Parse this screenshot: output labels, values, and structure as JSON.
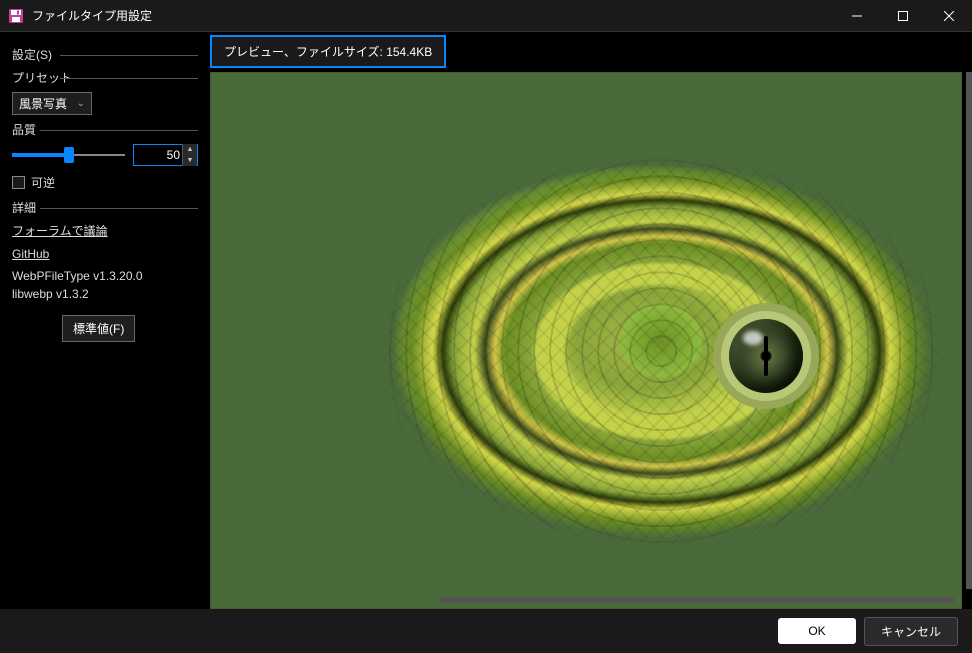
{
  "window": {
    "title": "ファイルタイプ用設定"
  },
  "settings": {
    "header_label": "設定(S)",
    "preset_label": "プリセット",
    "preset_value": "風景写真",
    "quality_label": "品質",
    "quality_value": "50",
    "lossless_label": "可逆",
    "details_label": "詳細",
    "forum_link": "フォーラムで議論",
    "github_link": "GitHub",
    "version1": "WebPFileType v1.3.20.0",
    "version2": "libwebp v1.3.2",
    "defaults_button": "標準値(F)"
  },
  "preview": {
    "tooltip_text": "プレビュー、ファイルサイズ: 154.4KB"
  },
  "footer": {
    "ok_label": "OK",
    "cancel_label": "キャンセル"
  }
}
